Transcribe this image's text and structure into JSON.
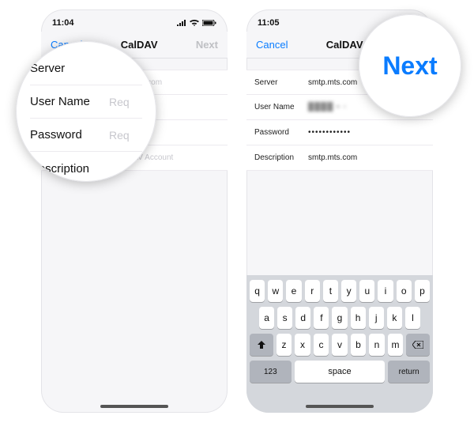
{
  "left": {
    "time": "11:04",
    "nav": {
      "cancel": "Cancel",
      "title": "CalDAV",
      "next": "Next"
    },
    "fields": {
      "server_label": "Server",
      "server_ph": "cal.example.com",
      "user_label": "User Name",
      "user_ph": "Required",
      "pass_label": "Password",
      "pass_ph": "Required",
      "desc_label": "Description",
      "desc_ph": "My CalDAV Account"
    },
    "lens": {
      "server": "Server",
      "user": "User Name",
      "user_ph": "Req",
      "pass": "Password",
      "pass_ph": "Req",
      "desc": "Description"
    }
  },
  "right": {
    "time": "11:05",
    "nav": {
      "cancel": "Cancel",
      "title": "CalDAV",
      "next": "Next"
    },
    "fields": {
      "server_label": "Server",
      "server_val": "smtp.mts.com",
      "user_label": "User Name",
      "user_val": "████ ▪ ▫",
      "pass_label": "Password",
      "pass_val": "••••••••••••",
      "desc_label": "Description",
      "desc_val": "smtp.mts.com"
    },
    "keyboard": {
      "row1": [
        "q",
        "w",
        "e",
        "r",
        "t",
        "y",
        "u",
        "i",
        "o",
        "p"
      ],
      "row2": [
        "a",
        "s",
        "d",
        "f",
        "g",
        "h",
        "j",
        "k",
        "l"
      ],
      "row3": [
        "z",
        "x",
        "c",
        "v",
        "b",
        "n",
        "m"
      ],
      "num": "123",
      "space": "space",
      "return": "return"
    },
    "lens_next": "Next"
  }
}
